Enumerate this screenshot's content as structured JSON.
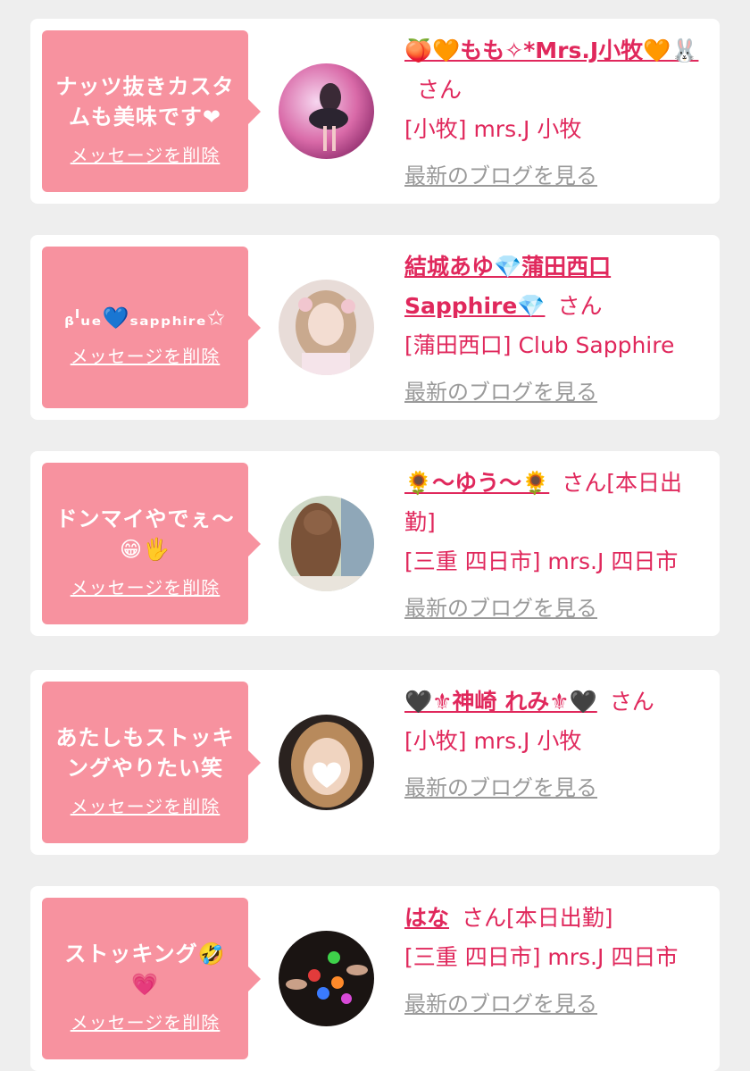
{
  "suffix": "さん",
  "delete_label": "メッセージを削除",
  "blog_label": "最新のブログを見る",
  "accent_color": "#e0285c",
  "bubble_color": "#f7929f",
  "cards": [
    {
      "message": "ナッツ抜きカスタムも美味です❤",
      "name": "🍑🧡もも✧*Mrs.J小牧🧡🐰",
      "status": "",
      "shop": "[小牧] mrs.J 小牧",
      "avatar_icon": "dancer-photo-avatar"
    },
    {
      "message": "ᵦˡᵤₑ💙ₛₐₚₚₕᵢᵣₑ✩",
      "name": "結城あゆ💎蒲田西口Sapphire💎",
      "status": "",
      "shop": "[蒲田西口] Club Sapphire",
      "avatar_icon": "portrait-photo-avatar"
    },
    {
      "message": "ドンマイやでぇ〜😁🖐",
      "name": "🌻〜ゆう〜🌻",
      "status": "[本日出勤]",
      "shop": "[三重 四日市] mrs.J 四日市",
      "avatar_icon": "hair-photo-avatar"
    },
    {
      "message": "あたしもストッキングやりたい笑",
      "name": "🖤⚜神崎 れみ⚜🖤",
      "status": "",
      "shop": "[小牧] mrs.J 小牧",
      "avatar_icon": "selfie-photo-avatar"
    },
    {
      "message": "ストッキング🤣💗",
      "name": "はな",
      "status": "[本日出勤]",
      "shop": "[三重 四日市] mrs.J 四日市",
      "avatar_icon": "drinks-photo-avatar"
    }
  ]
}
